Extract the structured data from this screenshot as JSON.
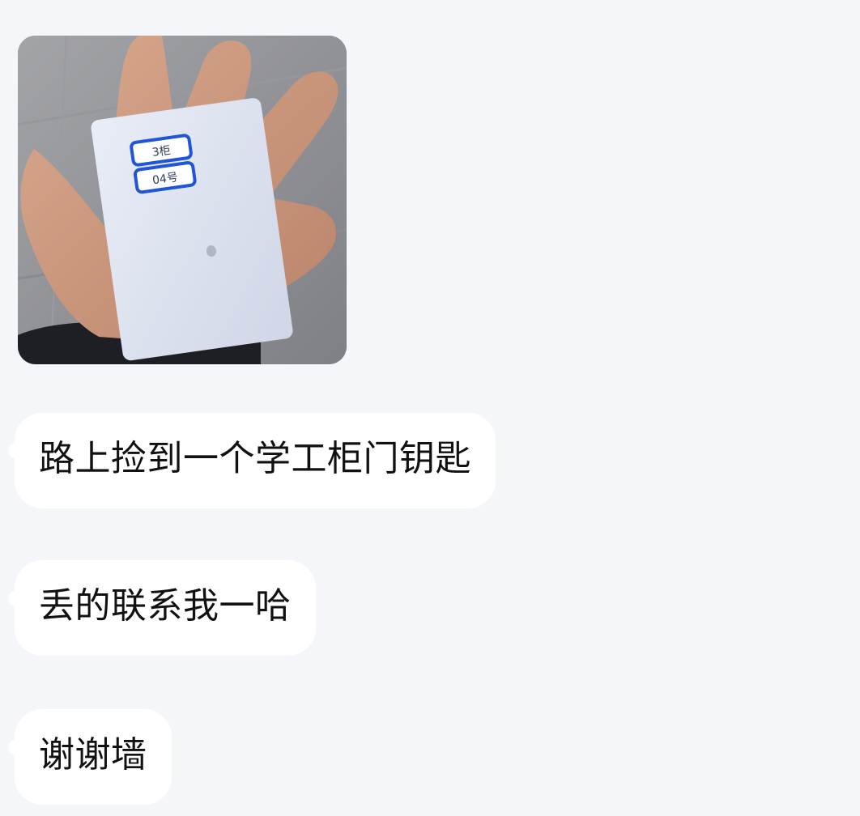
{
  "conversation": {
    "messages": [
      {
        "type": "image",
        "description_icon": "photo-icon"
      },
      {
        "type": "text",
        "text": "路上捡到一个学工柜门钥匙"
      },
      {
        "type": "text",
        "text": "丢的联系我一哈"
      },
      {
        "type": "text",
        "text": "谢谢墙"
      }
    ]
  },
  "photo": {
    "tag_top": "3柜",
    "tag_bottom": "04号"
  },
  "colors": {
    "background": "#f5f6fa",
    "bubble": "#ffffff",
    "text": "#111111",
    "tag_border": "#1f55d6"
  }
}
